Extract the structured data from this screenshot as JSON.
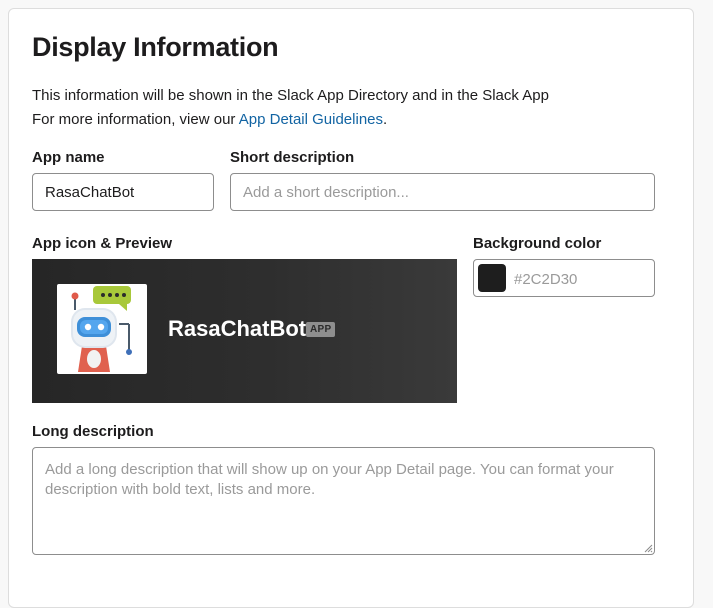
{
  "section": {
    "title": "Display Information",
    "intro_line1": "This information will be shown in the Slack App Directory and in the Slack App",
    "intro_line2_prefix": "For more information, view our ",
    "intro_link": "App Detail Guidelines",
    "intro_line2_suffix": "."
  },
  "fields": {
    "app_name": {
      "label": "App name",
      "value": "RasaChatBot"
    },
    "short_description": {
      "label": "Short description",
      "value": "",
      "placeholder": "Add a short description..."
    },
    "app_icon": {
      "label": "App icon & Preview",
      "icon": "robot-icon"
    },
    "background_color": {
      "label": "Background color",
      "value": "",
      "placeholder": "#2C2D30",
      "swatch_color": "#1e1e1e"
    },
    "long_description": {
      "label": "Long description",
      "value": "",
      "placeholder": "Add a long description that will show up on your App Detail page. You can format your description with bold text, lists and more."
    }
  },
  "preview": {
    "app_name": "RasaChatBot",
    "badge": "APP"
  },
  "colors": {
    "link": "#1264a3",
    "preview_background": "#2c2c2c"
  }
}
